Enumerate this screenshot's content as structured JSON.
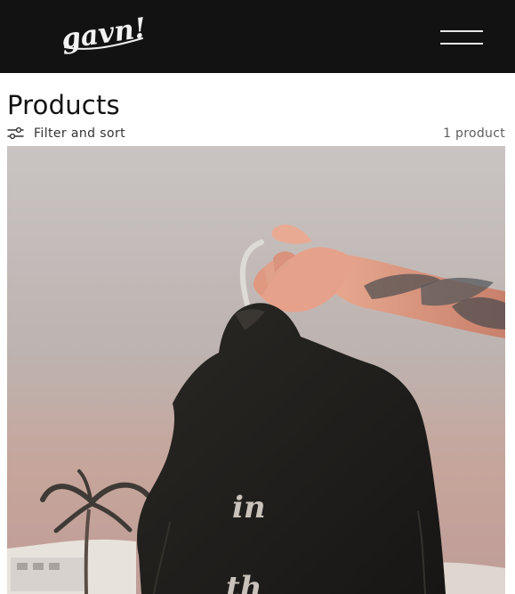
{
  "header": {
    "brand": "gavn!",
    "menu_icon": "hamburger-menu-icon"
  },
  "main": {
    "title": "Products",
    "filter_label": "Filter and sort",
    "filter_icon": "filter-sliders-icon",
    "product_count": "1 product"
  },
  "product": {
    "garment_text_lines": [
      "in",
      "th"
    ]
  },
  "colors": {
    "header_background": "#121212",
    "header_foreground": "#f2f2f2",
    "page_background": "#ffffff",
    "text": "#111111"
  }
}
